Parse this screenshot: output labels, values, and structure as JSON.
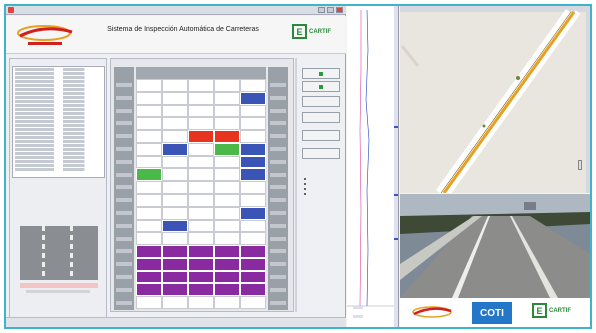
{
  "app": {
    "window_title": "",
    "title": "Sistema de Inspección Automática de Carreteras",
    "subtitle": ""
  },
  "logos": {
    "header_left": "",
    "header_right": "CARTIF",
    "bottom_left": "",
    "bottom_center": "COTI",
    "bottom_right": "CARTIF"
  },
  "left_panel": {
    "blue_link": "",
    "red_link": ""
  },
  "right_buttons": [
    "",
    "",
    "",
    "",
    "",
    ""
  ],
  "legend": [
    "",
    "",
    "",
    ""
  ],
  "colors": {
    "accent_frame": "#3fb3c9",
    "cell_blue": "#3a55b5",
    "cell_red": "#e8341f",
    "cell_green": "#4bb94a",
    "cell_purple": "#8a2aa0",
    "map_road": "#e8a020"
  },
  "grid": {
    "rows": 18,
    "cols": 5,
    "cells": [
      {
        "r": 1,
        "c": 4,
        "color": "blue"
      },
      {
        "r": 4,
        "c": 2,
        "color": "red"
      },
      {
        "r": 4,
        "c": 3,
        "color": "red"
      },
      {
        "r": 5,
        "c": 1,
        "color": "blue"
      },
      {
        "r": 5,
        "c": 3,
        "color": "green"
      },
      {
        "r": 5,
        "c": 4,
        "color": "blue"
      },
      {
        "r": 6,
        "c": 4,
        "color": "blue"
      },
      {
        "r": 7,
        "c": 0,
        "color": "green"
      },
      {
        "r": 7,
        "c": 4,
        "color": "blue"
      },
      {
        "r": 10,
        "c": 4,
        "color": "blue"
      },
      {
        "r": 11,
        "c": 1,
        "color": "blue"
      },
      {
        "r": 13,
        "c": 0,
        "color": "purple"
      },
      {
        "r": 13,
        "c": 1,
        "color": "purple"
      },
      {
        "r": 13,
        "c": 2,
        "color": "purple"
      },
      {
        "r": 13,
        "c": 3,
        "color": "purple"
      },
      {
        "r": 13,
        "c": 4,
        "color": "purple"
      },
      {
        "r": 14,
        "c": 0,
        "color": "purple"
      },
      {
        "r": 14,
        "c": 1,
        "color": "purple"
      },
      {
        "r": 14,
        "c": 2,
        "color": "purple"
      },
      {
        "r": 14,
        "c": 3,
        "color": "purple"
      },
      {
        "r": 14,
        "c": 4,
        "color": "purple"
      },
      {
        "r": 15,
        "c": 0,
        "color": "purple"
      },
      {
        "r": 15,
        "c": 1,
        "color": "purple"
      },
      {
        "r": 15,
        "c": 2,
        "color": "purple"
      },
      {
        "r": 15,
        "c": 3,
        "color": "purple"
      },
      {
        "r": 15,
        "c": 4,
        "color": "purple"
      },
      {
        "r": 16,
        "c": 0,
        "color": "purple"
      },
      {
        "r": 16,
        "c": 1,
        "color": "purple"
      },
      {
        "r": 16,
        "c": 2,
        "color": "purple"
      },
      {
        "r": 16,
        "c": 3,
        "color": "purple"
      },
      {
        "r": 16,
        "c": 4,
        "color": "purple"
      }
    ]
  },
  "icons": {
    "app": "app-icon",
    "minimize": "minimize-icon",
    "maximize": "maximize-icon",
    "close": "close-icon"
  }
}
